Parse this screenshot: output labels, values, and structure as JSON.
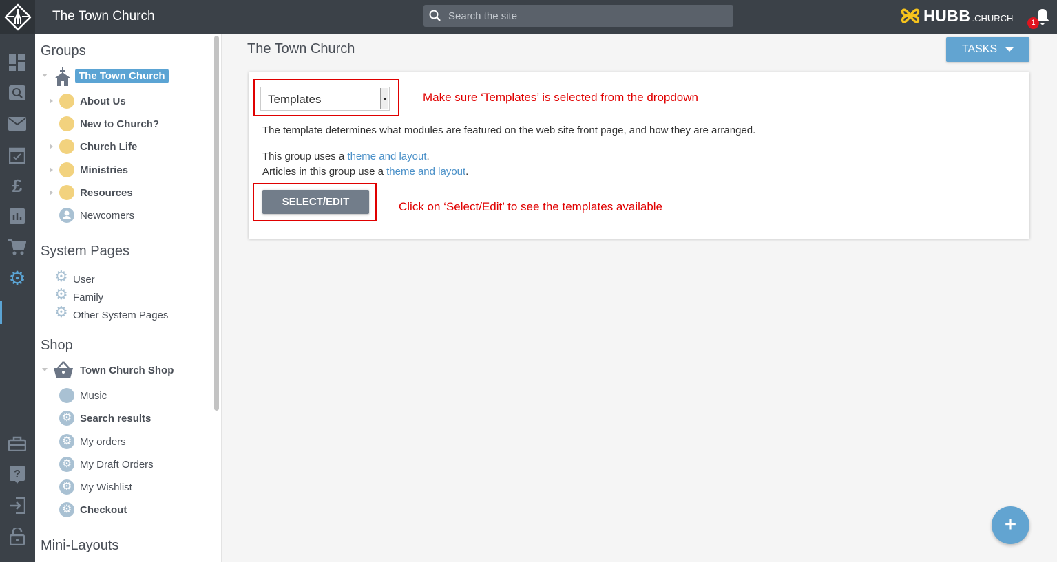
{
  "header": {
    "title": "The Town Church",
    "search_placeholder": "Search the site",
    "brand_main": "HUBB",
    "brand_suffix": ".CHURCH",
    "notification_count": "1"
  },
  "rail": {
    "icons": [
      "dashboard-icon",
      "search-icon",
      "mail-icon",
      "calendar-icon",
      "pound-icon",
      "chart-icon",
      "cart-icon",
      "gear-icon",
      "briefcase-icon",
      "help-icon",
      "login-icon",
      "lock-icon"
    ],
    "active": "gear-icon"
  },
  "sidebar": {
    "groups_heading": "Groups",
    "root": "The Town Church",
    "groups": [
      {
        "label": "About Us",
        "expandable": true
      },
      {
        "label": "New to Church?",
        "expandable": false
      },
      {
        "label": "Church Life",
        "expandable": true
      },
      {
        "label": "Ministries",
        "expandable": true
      },
      {
        "label": "Resources",
        "expandable": true
      },
      {
        "label": "Newcomers",
        "expandable": false
      }
    ],
    "system_heading": "System Pages",
    "system": [
      "User",
      "Family",
      "Other System Pages"
    ],
    "shop_heading": "Shop",
    "shop_root": "Town Church Shop",
    "shop": [
      "Music",
      "Search results",
      "My orders",
      "My Draft Orders",
      "My Wishlist",
      "Checkout"
    ],
    "mini_heading": "Mini-Layouts"
  },
  "main": {
    "title": "The Town Church",
    "tasks_label": "TASKS",
    "dropdown_value": "Templates",
    "note1": "Make sure ‘Templates’ is selected from the dropdown",
    "description": "The template determines what modules are featured on the web site front page, and how they are arranged.",
    "line1_prefix": "This group uses a ",
    "line1_link": "theme and layout",
    "line2_prefix": "Articles in this group use a ",
    "line2_link": "theme and layout",
    "period": ".",
    "button_label": "SELECT/EDIT",
    "note2": "Click on ‘Select/Edit’ to see the templates available",
    "fab": "+"
  },
  "colors": {
    "accent": "#62a4d1",
    "annotation": "#e00000",
    "topbar": "#3b4148",
    "folder": "#f2d27e"
  }
}
